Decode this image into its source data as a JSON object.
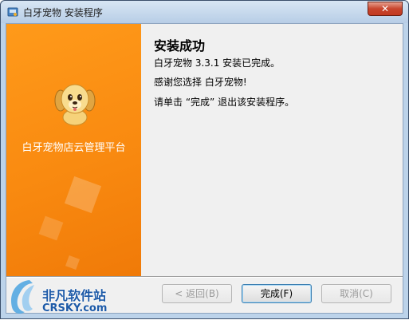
{
  "window": {
    "title": "白牙宠物 安装程序",
    "close_glyph": "✕"
  },
  "side_panel": {
    "title": "白牙宠物店云管理平台",
    "mascot_icon": "dog-mascot-icon",
    "background_color": "#f98a10"
  },
  "content": {
    "heading": "安装成功",
    "line1": "白牙宠物 3.3.1 安装已完成。",
    "line2": "感谢您选择 白牙宠物!",
    "line3": "请单击 “完成” 退出该安装程序。"
  },
  "buttons": {
    "back": "< 返回(B)",
    "finish": "完成(F)",
    "cancel": "取消(C)"
  },
  "watermark": {
    "brand": "非凡软件站",
    "domain": "CRSKY.com"
  }
}
